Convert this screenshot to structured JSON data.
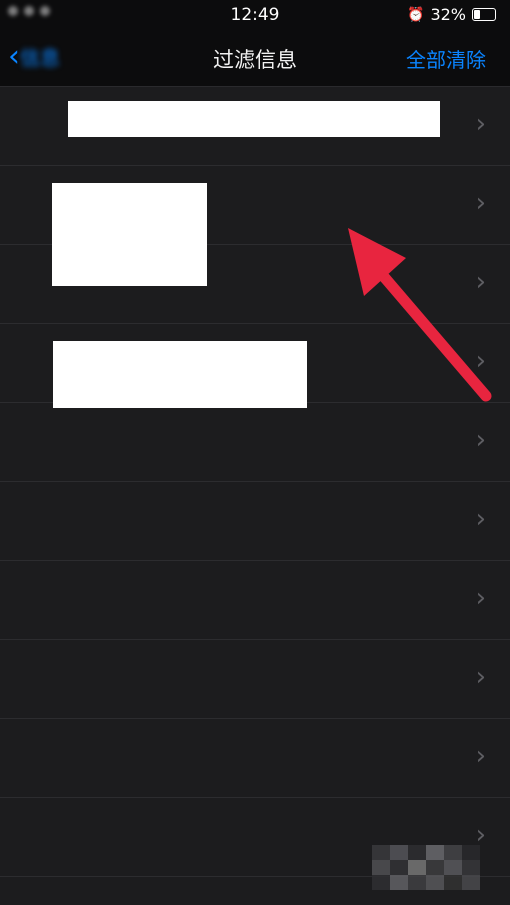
{
  "status_bar": {
    "time": "12:49",
    "battery": "32%",
    "battery_level": 0.32
  },
  "nav": {
    "title": "过滤信息",
    "clear_all": "全部清除",
    "back_label": "信息"
  },
  "rows": [
    {
      "title": "",
      "date": ""
    },
    {
      "title": "",
      "date": ""
    },
    {
      "title": "",
      "date": ""
    },
    {
      "title": "",
      "date": ""
    },
    {
      "title": "",
      "date": ""
    },
    {
      "title": "",
      "date": ""
    },
    {
      "title": "",
      "date": ""
    },
    {
      "title": "",
      "date": ""
    },
    {
      "title": "",
      "date": ""
    },
    {
      "title": "",
      "date": ""
    }
  ],
  "colors": {
    "accent": "#0a84ff",
    "annotation": "#e8253f",
    "background": "#1c1c1e"
  }
}
